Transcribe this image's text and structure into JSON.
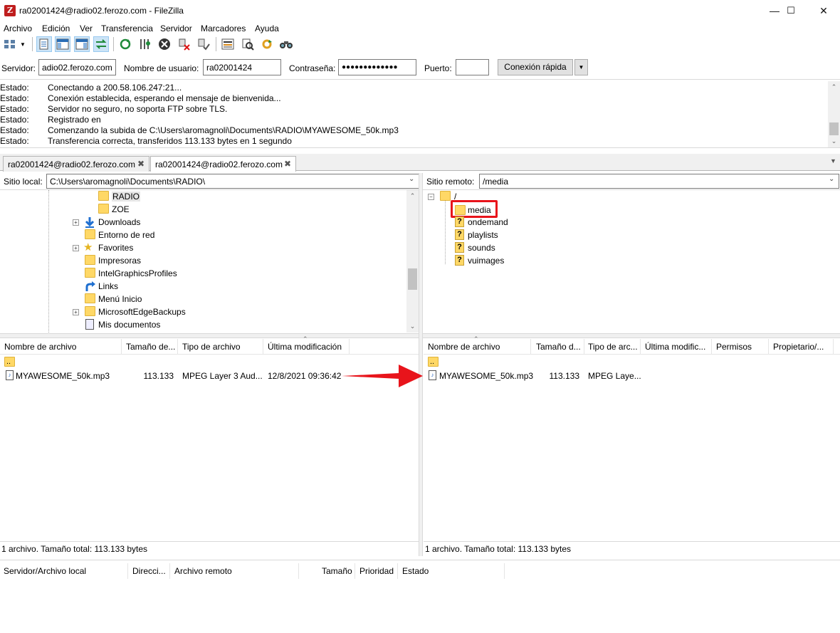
{
  "window": {
    "title": "ra02001424@radio02.ferozo.com - FileZilla",
    "minimize_glyph": "—",
    "maximize_glyph": "☐",
    "close_glyph": "✕"
  },
  "menu": [
    "Archivo",
    "Edición",
    "Ver",
    "Transferencia",
    "Servidor",
    "Marcadores",
    "Ayuda"
  ],
  "toolbar": {
    "icons": [
      "site-manager-icon",
      "dropdown-arrow-icon",
      "toggle-log-icon",
      "toggle-local-tree-icon",
      "toggle-remote-tree-icon",
      "toggle-queue-icon",
      "refresh-icon",
      "process-queue-icon",
      "cancel-icon",
      "disconnect-icon",
      "reconnect-icon",
      "directory-listing-filter-icon",
      "toggle-comparison-icon",
      "sync-browsing-icon",
      "search-icon"
    ]
  },
  "quickconnect": {
    "host_label": "Servidor:",
    "host_value": "adio02.ferozo.com",
    "user_label": "Nombre de usuario:",
    "user_value": "ra02001424",
    "pass_label": "Contraseña:",
    "pass_value": "●●●●●●●●●●●●●",
    "port_label": "Puerto:",
    "port_value": "",
    "connect_label": "Conexión rápida",
    "dropdown_glyph": "▼"
  },
  "log": [
    {
      "k": "Estado:",
      "v": "Conectando a 200.58.106.247:21..."
    },
    {
      "k": "Estado:",
      "v": "Conexión establecida, esperando el mensaje de bienvenida..."
    },
    {
      "k": "Estado:",
      "v": "Servidor no seguro, no soporta FTP sobre TLS."
    },
    {
      "k": "Estado:",
      "v": "Registrado en"
    },
    {
      "k": "Estado:",
      "v": "Comenzando la subida de C:\\Users\\aromagnoli\\Documents\\RADIO\\MYAWESOME_50k.mp3"
    },
    {
      "k": "Estado:",
      "v": "Transferencia correcta, transferidos 113.133 bytes en 1 segundo"
    }
  ],
  "tabs": [
    {
      "label": "ra02001424@radio02.ferozo.com",
      "close": "✖"
    },
    {
      "label": "ra02001424@radio02.ferozo.com",
      "close": "✖"
    }
  ],
  "local": {
    "site_label": "Sitio local:",
    "path": "C:\\Users\\aromagnoli\\Documents\\RADIO\\",
    "tree": [
      {
        "label": "RADIO",
        "selected": true
      },
      {
        "label": "ZOE"
      },
      {
        "label": "Downloads"
      },
      {
        "label": "Entorno de red"
      },
      {
        "label": "Favorites"
      },
      {
        "label": "Impresoras"
      },
      {
        "label": "IntelGraphicsProfiles"
      },
      {
        "label": "Links"
      },
      {
        "label": "Menú Inicio"
      },
      {
        "label": "MicrosoftEdgeBackups"
      },
      {
        "label": "Mis documentos"
      }
    ],
    "columns": [
      "Nombre de archivo",
      "Tamaño de...",
      "Tipo de archivo",
      "Última modificación"
    ],
    "parent": "..",
    "files": [
      {
        "name": "MYAWESOME_50k.mp3",
        "size": "113.133",
        "type": "MPEG Layer 3 Aud...",
        "modified": "12/8/2021 09:36:42"
      }
    ],
    "status": "1 archivo. Tamaño total: 113.133 bytes"
  },
  "remote": {
    "site_label": "Sitio remoto:",
    "path": "/media",
    "tree": [
      {
        "label": "/"
      },
      {
        "label": "media",
        "highlighted": true
      },
      {
        "label": "ondemand"
      },
      {
        "label": "playlists"
      },
      {
        "label": "sounds"
      },
      {
        "label": "vuimages"
      }
    ],
    "unknown_glyph": "?",
    "columns": [
      "Nombre de archivo",
      "Tamaño d...",
      "Tipo de arc...",
      "Última modific...",
      "Permisos",
      "Propietario/..."
    ],
    "parent": "..",
    "files": [
      {
        "name": "MYAWESOME_50k.mp3",
        "size": "113.133",
        "type": "MPEG Laye..."
      }
    ],
    "status": "1 archivo. Tamaño total: 113.133 bytes"
  },
  "queue": {
    "columns": [
      "Servidor/Archivo local",
      "Direcci...",
      "Archivo remoto",
      "Tamaño",
      "Prioridad",
      "Estado"
    ]
  },
  "annotation_colors": {
    "arrow": "#e8141b",
    "highlight_box": "#e8141b"
  }
}
